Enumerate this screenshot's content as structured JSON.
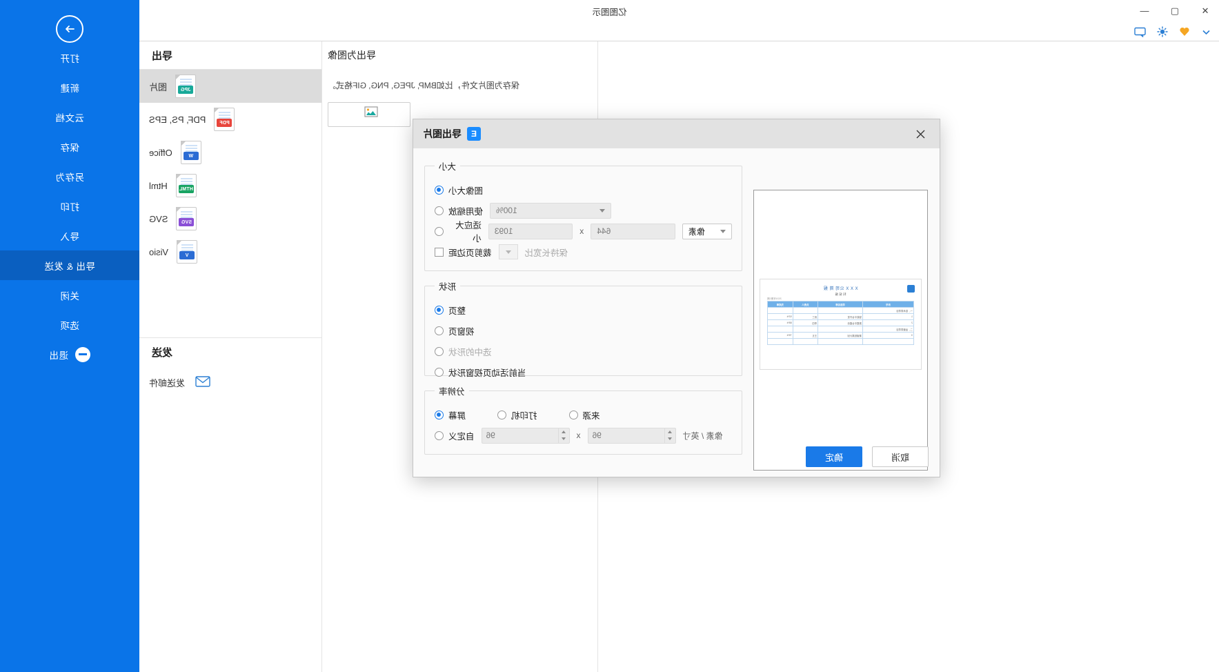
{
  "window": {
    "title": "亿图图示",
    "buttons": {
      "close": "✕",
      "maximize": "▢",
      "minimize": "—"
    }
  },
  "quick_access": {
    "icons": [
      "heart-icon",
      "sun-icon",
      "comment-icon",
      "chevron-down-icon"
    ]
  },
  "sidebar": {
    "back_icon": "arrow-right-icon",
    "items": [
      {
        "label": "打开",
        "active": false
      },
      {
        "label": "新建",
        "active": false
      },
      {
        "label": "云文档",
        "active": false
      },
      {
        "label": "保存",
        "active": false
      },
      {
        "label": "另存为",
        "active": false
      },
      {
        "label": "打印",
        "active": false
      },
      {
        "label": "导入",
        "active": false
      },
      {
        "label": "导出 & 发送",
        "active": true
      },
      {
        "label": "关闭",
        "active": false
      },
      {
        "label": "选项",
        "active": false
      }
    ],
    "exit": {
      "label": "退出",
      "icon": "minus-circle-icon"
    }
  },
  "backstage": {
    "export_heading": "导出",
    "formats": [
      {
        "label": "图片",
        "tag": "JPG",
        "color": "#18a999",
        "selected": true
      },
      {
        "label": "PDF, PS, EPS",
        "tag": "PDF",
        "color": "#e8453c",
        "selected": false
      },
      {
        "label": "Office",
        "tag": "W",
        "color": "#2b6cd4",
        "selected": false
      },
      {
        "label": "Html",
        "tag": "HTML",
        "color": "#19a463",
        "selected": false
      },
      {
        "label": "SVG",
        "tag": "SVG",
        "color": "#8a4fd6",
        "selected": false
      },
      {
        "label": "Visio",
        "tag": "V",
        "color": "#2b6cd4",
        "selected": false
      }
    ],
    "send_heading": "发送",
    "send_items": [
      {
        "label": "发送邮件",
        "icon": "mail-icon"
      }
    ],
    "detail": {
      "title": "导出为图像",
      "description": "保存为图片文件，比如BMP, JPEG, PNG, GIF格式。",
      "button_icon": "image-export-icon"
    }
  },
  "dialog": {
    "title": "导出图片",
    "logo": "E",
    "close_icon": "close-icon",
    "preview": {
      "doc_title": "X X X 公司 简 报",
      "doc_sub": "科 技 报",
      "badge_icon": "info-badge-icon",
      "note": "2024年第1期",
      "table": {
        "headers": [
          "序号",
          "项目名称",
          "负责人",
          "完成率"
        ],
        "rows": [
          [
            "一、技术类项目",
            "",
            "",
            ""
          ],
          [
            "1",
            "智能平台开发",
            "张三",
            "92%"
          ],
          [
            "2",
            "数据中台建设",
            "李四",
            "88%"
          ],
          [
            "二、运营类项目",
            "",
            "",
            ""
          ],
          [
            "3",
            "渠道拓展计划",
            "王五",
            "75%"
          ],
          [
            "",
            "",
            "",
            ""
          ]
        ]
      }
    },
    "size": {
      "legend": "大小",
      "options": [
        {
          "label": "图像大小",
          "selected": true
        },
        {
          "label": "使用缩放",
          "selected": false
        },
        {
          "label": "适应大小",
          "selected": false
        }
      ],
      "scale_value": "100%",
      "width": "1093",
      "height": "644",
      "x_separator": "x",
      "unit": "像素",
      "crop_margin_label": "裁剪页边距",
      "crop_margin_checked": false,
      "aspect_label": "保持长宽比",
      "aspect_enabled": false
    },
    "shape": {
      "legend": "形状",
      "options": [
        {
          "label": "整页",
          "selected": true,
          "disabled": false
        },
        {
          "label": "视窗页",
          "selected": false,
          "disabled": false
        },
        {
          "label": "选中的形状",
          "selected": false,
          "disabled": true
        },
        {
          "label": "当前活动页视窗形状",
          "selected": false,
          "disabled": false
        }
      ]
    },
    "resolution": {
      "legend": "分辨率",
      "options": [
        {
          "label": "屏幕",
          "selected": true
        },
        {
          "label": "打印机",
          "selected": false
        },
        {
          "label": "来源",
          "selected": false
        },
        {
          "label": "自定义",
          "selected": false
        }
      ],
      "dpi_x": "96",
      "dpi_y": "96",
      "x_separator": "x",
      "unit": "像素 / 英寸"
    },
    "footer": {
      "ok": "确定",
      "cancel": "取消"
    }
  },
  "colors": {
    "brand_blue": "#0a74e8",
    "active_blue": "#0a5fc0",
    "accent": "#1a7ae8",
    "dialog_header": "#e2e2e2"
  }
}
